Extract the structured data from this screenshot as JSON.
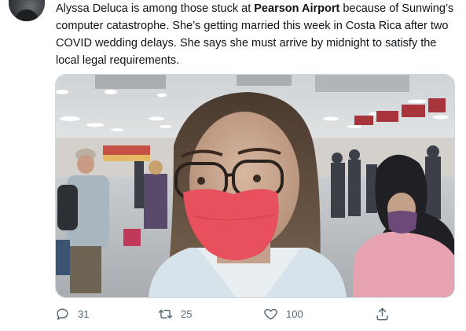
{
  "tweet": {
    "text_before": "Alyssa Deluca is among those stuck at ",
    "text_bold": "Pearson  Airport",
    "text_after": " because of Sunwing’s computer catastrophe. She’s getting married this week in Costa Rica after two COVID wedding delays. She says she must arrive by midnight to satisfy the local legal requirements."
  },
  "actions": {
    "reply_count": "31",
    "retweet_count": "25",
    "like_count": "100"
  },
  "icons": {
    "reply": "reply-icon",
    "retweet": "retweet-icon",
    "like": "heart-icon",
    "share": "share-icon"
  },
  "colors": {
    "action_gray": "#536471",
    "text": "#0f1419",
    "mask": "#e8505e"
  }
}
